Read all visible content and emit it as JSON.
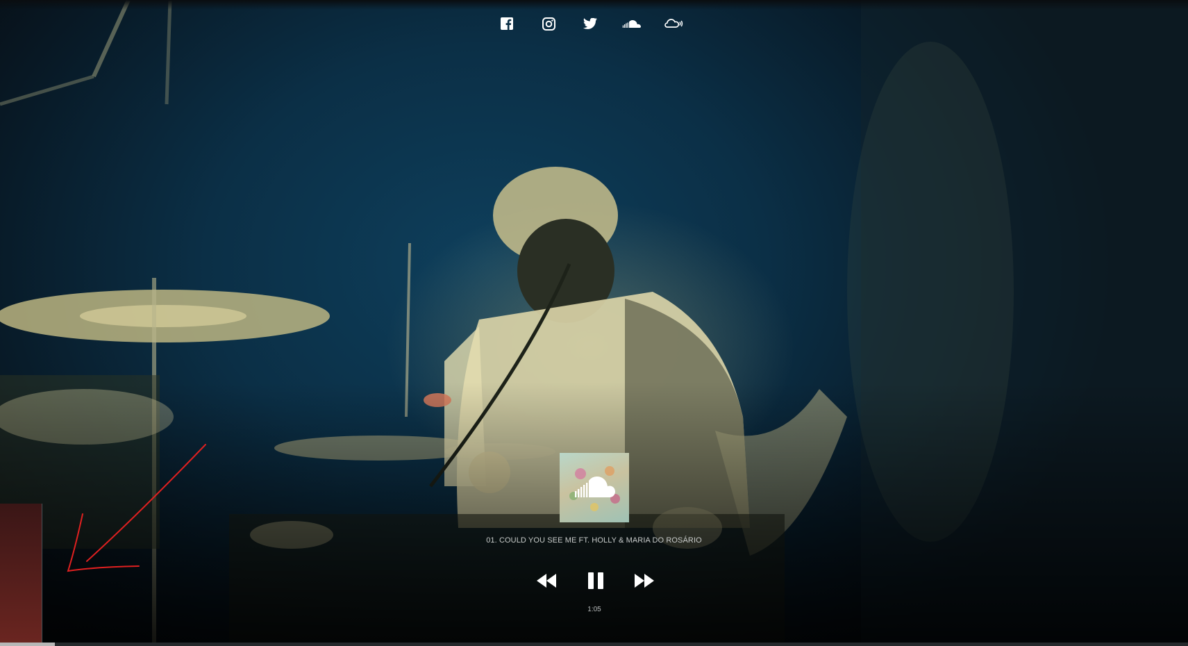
{
  "social": {
    "icons": [
      "facebook-icon",
      "instagram-icon",
      "twitter-icon",
      "soundcloud-icon",
      "mixcloud-icon"
    ]
  },
  "player": {
    "artwork_icon": "soundcloud-icon",
    "track_title": "01. COULD YOU SEE ME FT. HOLLY & MARIA DO ROSÁRIO",
    "time": "1:05",
    "state": "playing",
    "progress_fraction": 0.046
  },
  "colors": {
    "background": "#0b2f46",
    "annotation": "#e02020",
    "text": "#c9cccb"
  }
}
